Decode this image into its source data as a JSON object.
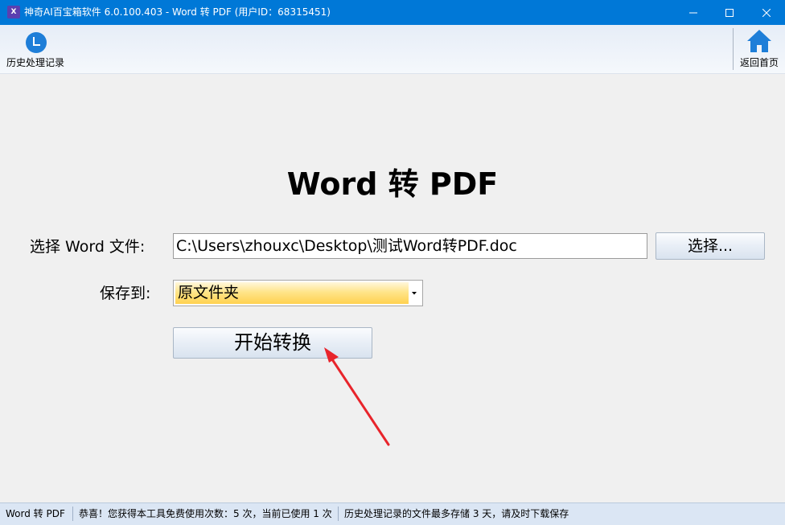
{
  "window": {
    "title": "神奇AI百宝箱软件 6.0.100.403 - Word 转 PDF (用户ID：68315451)",
    "app_icon_text": "X",
    "controls": [
      "minimize-icon",
      "maximize-icon",
      "close-icon"
    ]
  },
  "toolbar": {
    "history_label": "历史处理记录",
    "history_icon": "clock-icon",
    "home_label": "返回首页",
    "home_icon": "home-icon"
  },
  "main": {
    "title": "Word 转 PDF",
    "file_label": "选择 Word 文件:",
    "file_path": "C:\\Users\\zhouxc\\Desktop\\测试Word转PDF.doc",
    "browse_button": "选择...",
    "save_label": "保存到:",
    "save_selected": "原文件夹",
    "start_button": "开始转换"
  },
  "statusbar": {
    "panel1": "Word 转 PDF",
    "panel2": "恭喜！您获得本工具免费使用次数：5 次，当前已使用 1 次",
    "panel3": "历史处理记录的文件最多存储 3 天，请及时下载保存"
  },
  "colors": {
    "titlebar": "#0078d7",
    "icon_blue": "#1e7ed8",
    "select_highlight": "#ffd14f",
    "annotation_arrow": "#e8242b"
  }
}
